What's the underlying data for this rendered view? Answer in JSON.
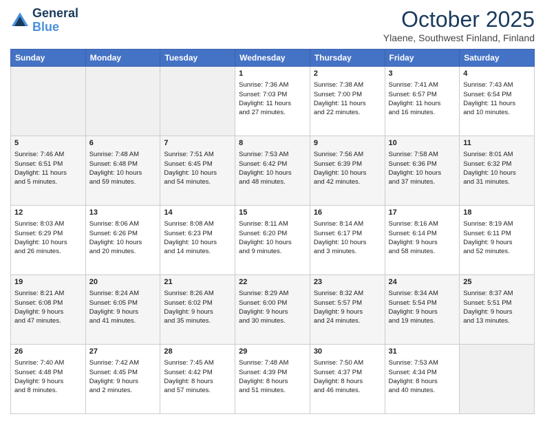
{
  "header": {
    "logo_line1": "General",
    "logo_line2": "Blue",
    "month": "October 2025",
    "location": "Ylaene, Southwest Finland, Finland"
  },
  "days_of_week": [
    "Sunday",
    "Monday",
    "Tuesday",
    "Wednesday",
    "Thursday",
    "Friday",
    "Saturday"
  ],
  "weeks": [
    [
      {
        "day": "",
        "data": ""
      },
      {
        "day": "",
        "data": ""
      },
      {
        "day": "",
        "data": ""
      },
      {
        "day": "1",
        "data": "Sunrise: 7:36 AM\nSunset: 7:03 PM\nDaylight: 11 hours\nand 27 minutes."
      },
      {
        "day": "2",
        "data": "Sunrise: 7:38 AM\nSunset: 7:00 PM\nDaylight: 11 hours\nand 22 minutes."
      },
      {
        "day": "3",
        "data": "Sunrise: 7:41 AM\nSunset: 6:57 PM\nDaylight: 11 hours\nand 16 minutes."
      },
      {
        "day": "4",
        "data": "Sunrise: 7:43 AM\nSunset: 6:54 PM\nDaylight: 11 hours\nand 10 minutes."
      }
    ],
    [
      {
        "day": "5",
        "data": "Sunrise: 7:46 AM\nSunset: 6:51 PM\nDaylight: 11 hours\nand 5 minutes."
      },
      {
        "day": "6",
        "data": "Sunrise: 7:48 AM\nSunset: 6:48 PM\nDaylight: 10 hours\nand 59 minutes."
      },
      {
        "day": "7",
        "data": "Sunrise: 7:51 AM\nSunset: 6:45 PM\nDaylight: 10 hours\nand 54 minutes."
      },
      {
        "day": "8",
        "data": "Sunrise: 7:53 AM\nSunset: 6:42 PM\nDaylight: 10 hours\nand 48 minutes."
      },
      {
        "day": "9",
        "data": "Sunrise: 7:56 AM\nSunset: 6:39 PM\nDaylight: 10 hours\nand 42 minutes."
      },
      {
        "day": "10",
        "data": "Sunrise: 7:58 AM\nSunset: 6:36 PM\nDaylight: 10 hours\nand 37 minutes."
      },
      {
        "day": "11",
        "data": "Sunrise: 8:01 AM\nSunset: 6:32 PM\nDaylight: 10 hours\nand 31 minutes."
      }
    ],
    [
      {
        "day": "12",
        "data": "Sunrise: 8:03 AM\nSunset: 6:29 PM\nDaylight: 10 hours\nand 26 minutes."
      },
      {
        "day": "13",
        "data": "Sunrise: 8:06 AM\nSunset: 6:26 PM\nDaylight: 10 hours\nand 20 minutes."
      },
      {
        "day": "14",
        "data": "Sunrise: 8:08 AM\nSunset: 6:23 PM\nDaylight: 10 hours\nand 14 minutes."
      },
      {
        "day": "15",
        "data": "Sunrise: 8:11 AM\nSunset: 6:20 PM\nDaylight: 10 hours\nand 9 minutes."
      },
      {
        "day": "16",
        "data": "Sunrise: 8:14 AM\nSunset: 6:17 PM\nDaylight: 10 hours\nand 3 minutes."
      },
      {
        "day": "17",
        "data": "Sunrise: 8:16 AM\nSunset: 6:14 PM\nDaylight: 9 hours\nand 58 minutes."
      },
      {
        "day": "18",
        "data": "Sunrise: 8:19 AM\nSunset: 6:11 PM\nDaylight: 9 hours\nand 52 minutes."
      }
    ],
    [
      {
        "day": "19",
        "data": "Sunrise: 8:21 AM\nSunset: 6:08 PM\nDaylight: 9 hours\nand 47 minutes."
      },
      {
        "day": "20",
        "data": "Sunrise: 8:24 AM\nSunset: 6:05 PM\nDaylight: 9 hours\nand 41 minutes."
      },
      {
        "day": "21",
        "data": "Sunrise: 8:26 AM\nSunset: 6:02 PM\nDaylight: 9 hours\nand 35 minutes."
      },
      {
        "day": "22",
        "data": "Sunrise: 8:29 AM\nSunset: 6:00 PM\nDaylight: 9 hours\nand 30 minutes."
      },
      {
        "day": "23",
        "data": "Sunrise: 8:32 AM\nSunset: 5:57 PM\nDaylight: 9 hours\nand 24 minutes."
      },
      {
        "day": "24",
        "data": "Sunrise: 8:34 AM\nSunset: 5:54 PM\nDaylight: 9 hours\nand 19 minutes."
      },
      {
        "day": "25",
        "data": "Sunrise: 8:37 AM\nSunset: 5:51 PM\nDaylight: 9 hours\nand 13 minutes."
      }
    ],
    [
      {
        "day": "26",
        "data": "Sunrise: 7:40 AM\nSunset: 4:48 PM\nDaylight: 9 hours\nand 8 minutes."
      },
      {
        "day": "27",
        "data": "Sunrise: 7:42 AM\nSunset: 4:45 PM\nDaylight: 9 hours\nand 2 minutes."
      },
      {
        "day": "28",
        "data": "Sunrise: 7:45 AM\nSunset: 4:42 PM\nDaylight: 8 hours\nand 57 minutes."
      },
      {
        "day": "29",
        "data": "Sunrise: 7:48 AM\nSunset: 4:39 PM\nDaylight: 8 hours\nand 51 minutes."
      },
      {
        "day": "30",
        "data": "Sunrise: 7:50 AM\nSunset: 4:37 PM\nDaylight: 8 hours\nand 46 minutes."
      },
      {
        "day": "31",
        "data": "Sunrise: 7:53 AM\nSunset: 4:34 PM\nDaylight: 8 hours\nand 40 minutes."
      },
      {
        "day": "",
        "data": ""
      }
    ]
  ]
}
